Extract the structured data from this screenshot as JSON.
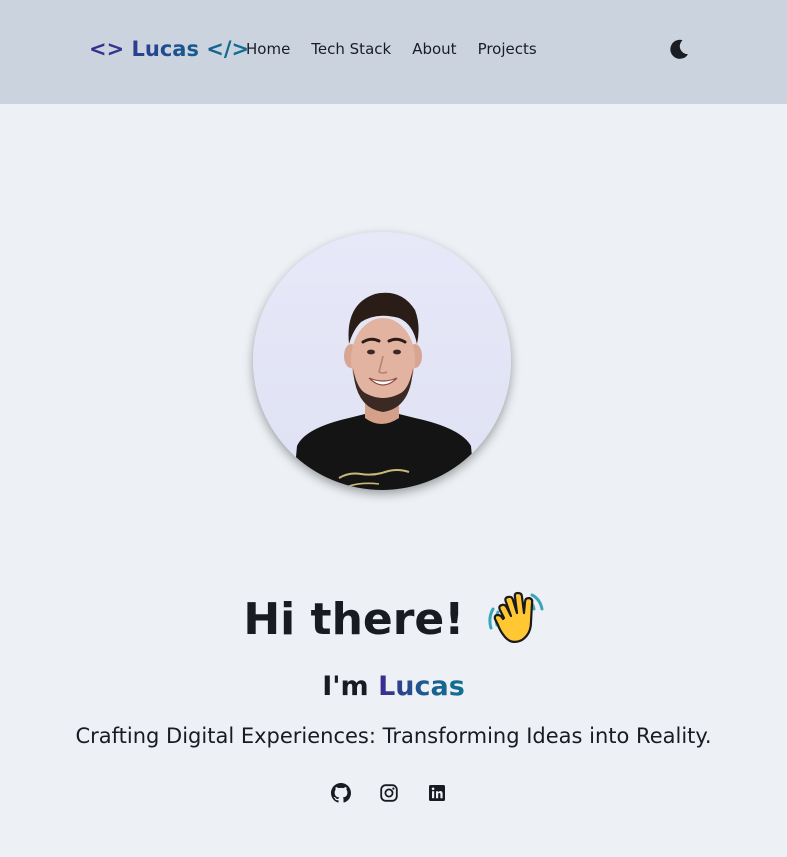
{
  "navbar": {
    "brand": "<> Lucas </>",
    "links": [
      {
        "label": "Home"
      },
      {
        "label": "Tech Stack"
      },
      {
        "label": "About"
      },
      {
        "label": "Projects"
      }
    ],
    "theme_toggle_icon": "moon-icon"
  },
  "hero": {
    "avatar_icon": "profile-photo",
    "title": "Hi there!",
    "wave_icon": "waving-hand-icon",
    "im_prefix": "I'm ",
    "name": "Lucas",
    "tagline": "Crafting Digital Experiences: Transforming Ideas into Reality."
  },
  "socials": [
    {
      "icon": "github-icon"
    },
    {
      "icon": "instagram-icon"
    },
    {
      "icon": "linkedin-icon"
    }
  ],
  "colors": {
    "navbar_bg": "#cbd3de",
    "page_bg": "#edf1f5",
    "brand_gradient_start": "#3b2a8f",
    "brand_gradient_end": "#0f7192",
    "text": "#181b22"
  }
}
